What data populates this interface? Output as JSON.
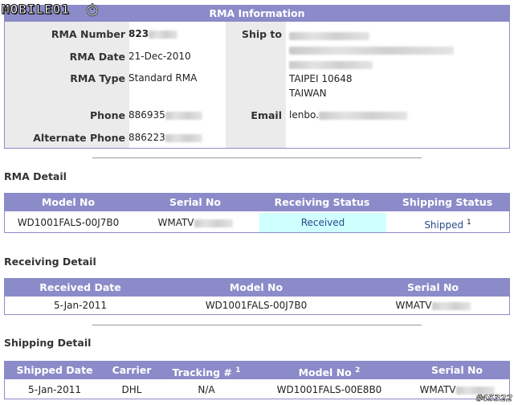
{
  "branding": {
    "logo_text": "MOBILE01",
    "watermark": "#45322"
  },
  "rma_info": {
    "title": "RMA Information",
    "rma_number": {
      "label": "RMA Number",
      "value": "823"
    },
    "rma_date": {
      "label": "RMA Date",
      "value": "21-Dec-2010"
    },
    "rma_type": {
      "label": "RMA Type",
      "value": "Standard RMA"
    },
    "phone": {
      "label": "Phone",
      "value": "886935"
    },
    "alt_phone": {
      "label": "Alternate Phone",
      "value": "886223"
    },
    "ship_to": {
      "label": "Ship to",
      "city": "TAIPEI 10648",
      "country": "TAIWAN"
    },
    "email": {
      "label": "Email",
      "value": "lenbo."
    }
  },
  "rma_detail": {
    "title": "RMA Detail",
    "headers": [
      "Model No",
      "Serial No",
      "Receiving Status",
      "Shipping Status"
    ],
    "row": {
      "model": "WD1001FALS-00J7B0",
      "serial": "WMATV",
      "receiving": "Received",
      "shipping": "Shipped",
      "shipping_note": "1"
    }
  },
  "receiving_detail": {
    "title": "Receiving Detail",
    "headers": [
      "Received Date",
      "Model No",
      "Serial No"
    ],
    "row": {
      "date": "5-Jan-2011",
      "model": "WD1001FALS-00J7B0",
      "serial": "WMATV"
    }
  },
  "shipping_detail": {
    "title": "Shipping Detail",
    "headers": [
      "Shipped Date",
      "Carrier",
      "Tracking #",
      "Model No",
      "Serial No"
    ],
    "tracking_note": "1",
    "model_note": "2",
    "row": {
      "date": "5-Jan-2011",
      "carrier": "DHL",
      "tracking": "N/A",
      "model": "WD1001FALS-00E8B0",
      "serial": "WMATV"
    }
  },
  "colors": {
    "header": "#8b8bc9",
    "label_column": "#ebebeb",
    "received_highlight": "#cfffff",
    "link": "#2a4a8a"
  }
}
